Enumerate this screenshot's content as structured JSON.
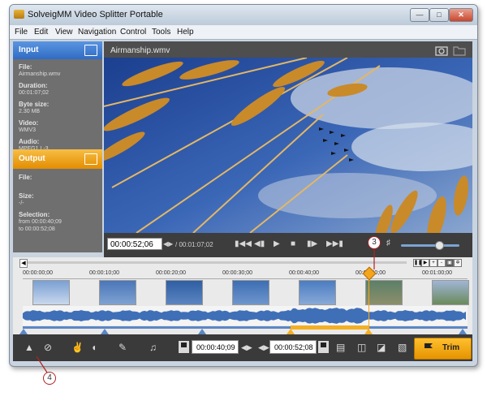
{
  "window": {
    "title": "SolveigMM Video Splitter Portable",
    "controls": [
      "minimize",
      "maximize",
      "close"
    ]
  },
  "menu": [
    "File",
    "Edit",
    "View",
    "Navigation",
    "Control",
    "Tools",
    "Help"
  ],
  "input_panel": {
    "header": "Input",
    "file_label": "File:",
    "file_value": "Airmanship.wmv",
    "duration_label": "Duration:",
    "duration_value": "00:01:07;02",
    "bytesize_label": "Byte size:",
    "bytesize_value": "2.30 MB",
    "video_label": "Video:",
    "video_value": "WMV3",
    "audio_label": "Audio:",
    "audio_value": "MPEG1 L-3"
  },
  "output_panel": {
    "header": "Output",
    "file_label": "File:",
    "file_value": "",
    "size_label": "Size:",
    "size_value": "-/-",
    "selection_label": "Selection:",
    "from_line": "from   00:00:40;09",
    "to_line": "to        00:00:52;08"
  },
  "player": {
    "filename": "Airmanship.wmv",
    "current_time": "00:00:52;06",
    "total_time": "/ 00:01:07;02",
    "volume": 0.65,
    "transport_icons": [
      "prev-marker-icon",
      "step-back-icon",
      "play-icon",
      "stop-icon",
      "step-forward-icon",
      "next-marker-icon"
    ]
  },
  "timeline": {
    "ticks": [
      "00:00:00;00",
      "00:00:10;00",
      "00:00:20;00",
      "00:00:30;00",
      "00:00:40;00",
      "00:00:50;00",
      "00:01:00;00"
    ],
    "cursor_fraction": 0.777,
    "selection_start_fraction": 0.602,
    "selection_end_fraction": 0.777
  },
  "selection": {
    "start": "00:00:40;09",
    "end": "00:00:52;08"
  },
  "actions": {
    "trim_label": "Trim"
  },
  "callouts": {
    "cursor": "3",
    "marker_button": "4"
  },
  "colors": {
    "accent": "#f3a51c",
    "input_header": "#3d7bd1",
    "output_header": "#f1a21a",
    "wave": "#3f6fb7"
  }
}
